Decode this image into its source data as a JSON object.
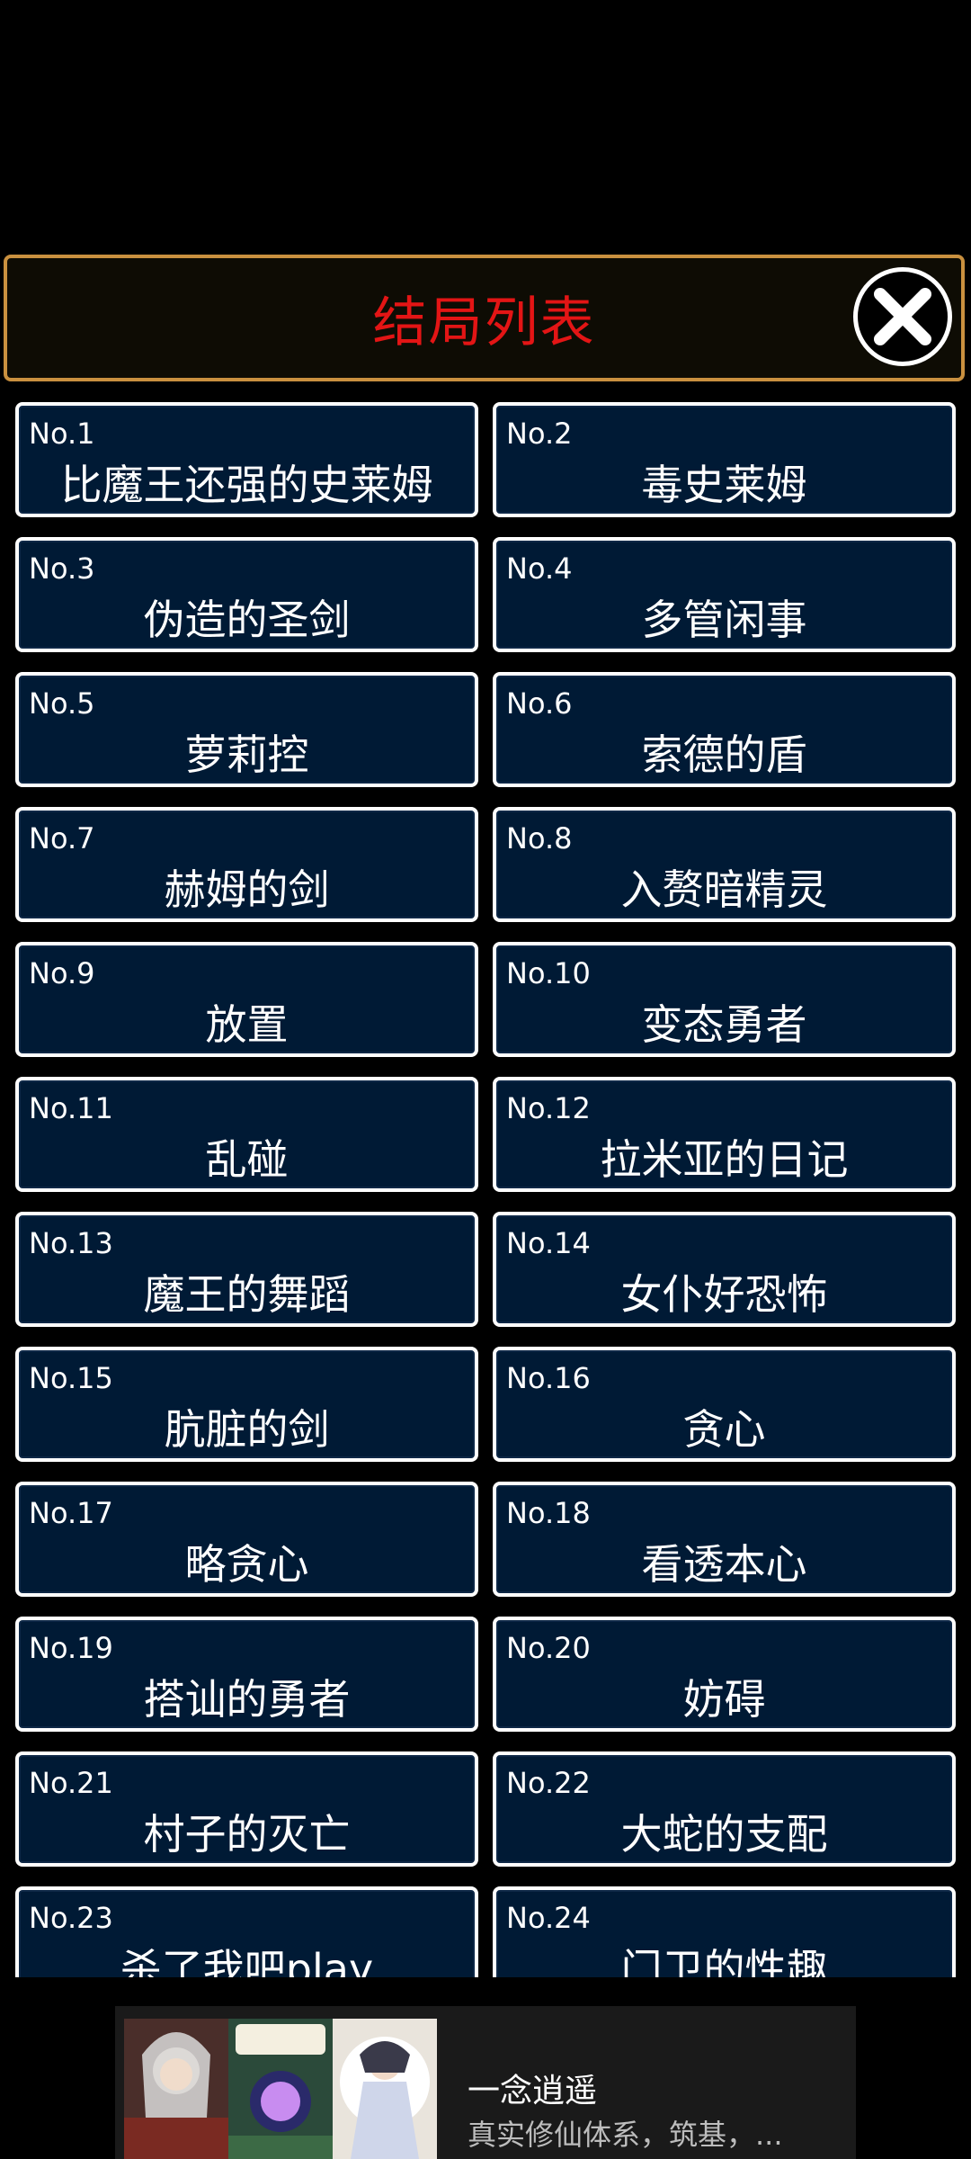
{
  "header": {
    "title": "结局列表"
  },
  "endings": [
    {
      "no": "No.1",
      "name": "比魔王还强的史莱姆"
    },
    {
      "no": "No.2",
      "name": "毒史莱姆"
    },
    {
      "no": "No.3",
      "name": "伪造的圣剑"
    },
    {
      "no": "No.4",
      "name": "多管闲事"
    },
    {
      "no": "No.5",
      "name": "萝莉控"
    },
    {
      "no": "No.6",
      "name": "索德的盾"
    },
    {
      "no": "No.7",
      "name": "赫姆的剑"
    },
    {
      "no": "No.8",
      "name": "入赘暗精灵"
    },
    {
      "no": "No.9",
      "name": "放置"
    },
    {
      "no": "No.10",
      "name": "变态勇者"
    },
    {
      "no": "No.11",
      "name": "乱碰"
    },
    {
      "no": "No.12",
      "name": "拉米亚的日记"
    },
    {
      "no": "No.13",
      "name": "魔王的舞蹈"
    },
    {
      "no": "No.14",
      "name": "女仆好恐怖"
    },
    {
      "no": "No.15",
      "name": "肮脏的剑"
    },
    {
      "no": "No.16",
      "name": "贪心"
    },
    {
      "no": "No.17",
      "name": "略贪心"
    },
    {
      "no": "No.18",
      "name": "看透本心"
    },
    {
      "no": "No.19",
      "name": "搭讪的勇者"
    },
    {
      "no": "No.20",
      "name": "妨碍"
    },
    {
      "no": "No.21",
      "name": "村子的灭亡"
    },
    {
      "no": "No.22",
      "name": "大蛇的支配"
    },
    {
      "no": "No.23",
      "name": "杀了我吧play"
    },
    {
      "no": "No.24",
      "name": "门卫的性趣"
    }
  ],
  "ad": {
    "title": "一念逍遥",
    "description": "真实修仙体系，筑基，..."
  },
  "colors": {
    "title_red": "#e31515",
    "header_border": "#c9903f",
    "card_bg": "#001a35"
  }
}
